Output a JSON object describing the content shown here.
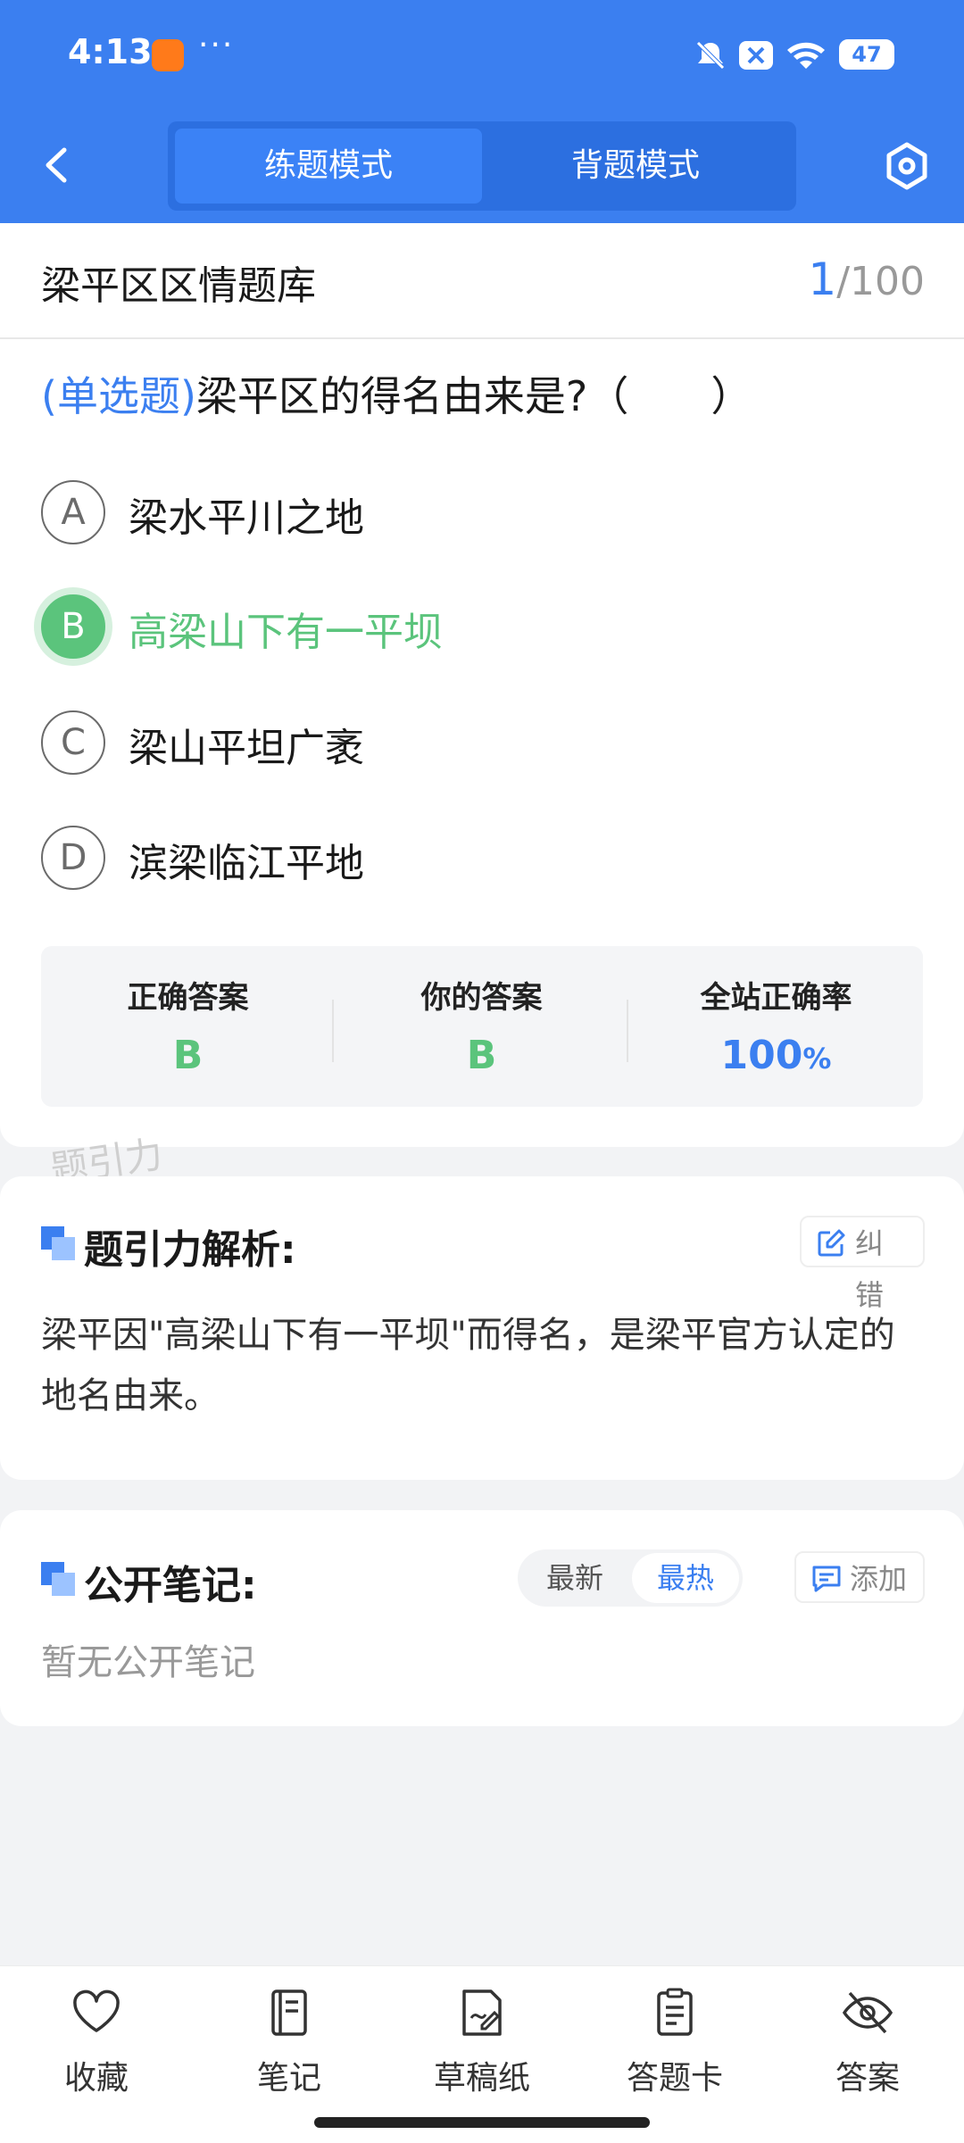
{
  "status_bar": {
    "time": "4:13",
    "battery": "47"
  },
  "header": {
    "modes": [
      "练题模式",
      "背题模式"
    ],
    "active_mode": "练题模式"
  },
  "bank": {
    "title": "梁平区区情题库",
    "current": "1",
    "total": "/100"
  },
  "question": {
    "type": "(单选题)",
    "text": "梁平区的得名由来是?（　　）",
    "options": [
      {
        "letter": "A",
        "text": "梁水平川之地"
      },
      {
        "letter": "B",
        "text": "高梁山下有一平坝"
      },
      {
        "letter": "C",
        "text": "梁山平坦广袤"
      },
      {
        "letter": "D",
        "text": "滨梁临江平地"
      }
    ],
    "selected": "B"
  },
  "result": {
    "correct_label": "正确答案",
    "correct_value": "B",
    "your_label": "你的答案",
    "your_value": "B",
    "rate_label": "全站正确率",
    "rate_value": "100",
    "rate_unit": "%"
  },
  "watermark": "题引力",
  "analysis": {
    "title": "题引力解析:",
    "report_label": "纠错",
    "text": "梁平因\"高梁山下有一平坝\"而得名，是梁平官方认定的地名由来。"
  },
  "notes": {
    "title": "公开笔记:",
    "sort_options": [
      "最新",
      "最热"
    ],
    "active_sort": "最热",
    "add_label": "添加",
    "empty_text": "暂无公开笔记"
  },
  "tabbar": [
    {
      "label": "收藏",
      "icon": "heart-icon"
    },
    {
      "label": "笔记",
      "icon": "notebook-icon"
    },
    {
      "label": "草稿纸",
      "icon": "draft-icon"
    },
    {
      "label": "答题卡",
      "icon": "answer-sheet-icon"
    },
    {
      "label": "答案",
      "icon": "eye-off-icon"
    }
  ],
  "colors": {
    "primary": "#3b7ff0",
    "correct": "#5bc47c"
  }
}
